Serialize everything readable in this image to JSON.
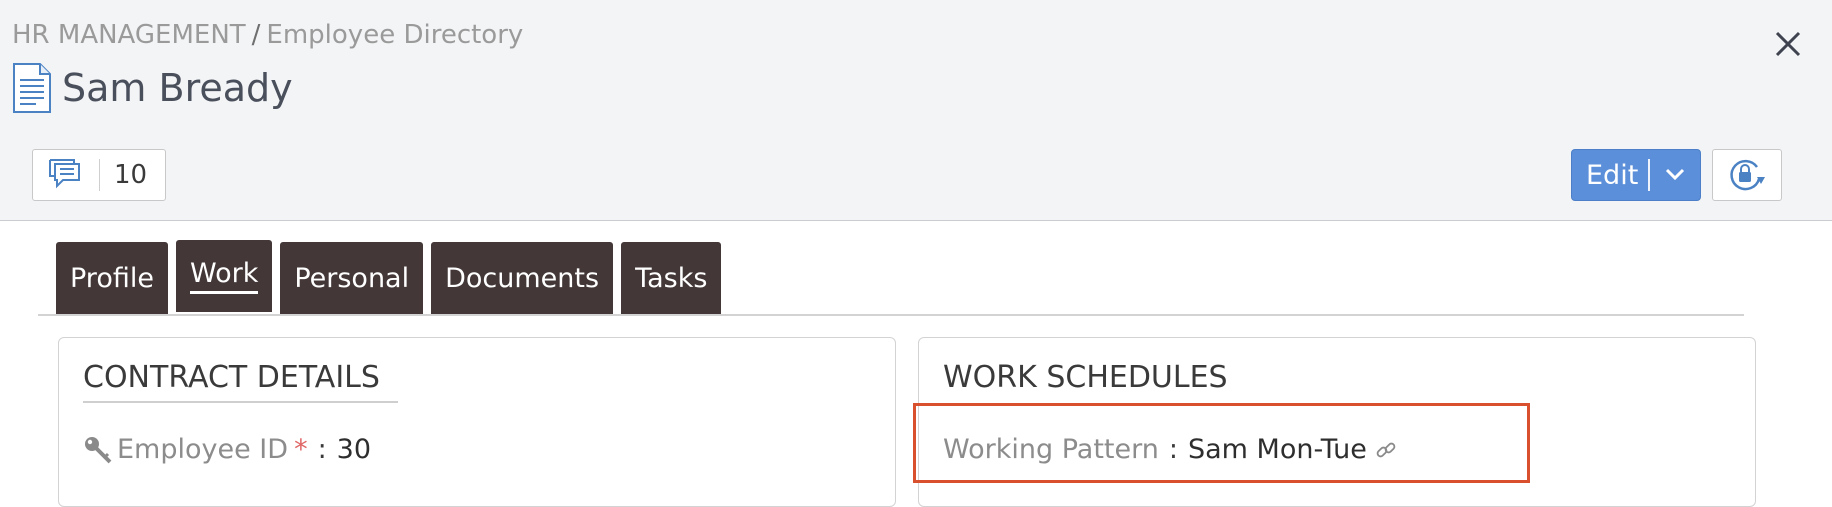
{
  "breadcrumb": {
    "section": "HR MANAGEMENT",
    "separator": "/",
    "page": "Employee Directory"
  },
  "record": {
    "title": "Sam Bready"
  },
  "header_actions": {
    "message_count": "10",
    "edit_label": "Edit"
  },
  "tabs": [
    {
      "label": "Profile",
      "active": false
    },
    {
      "label": "Work",
      "active": true
    },
    {
      "label": "Personal",
      "active": false
    },
    {
      "label": "Documents",
      "active": false
    },
    {
      "label": "Tasks",
      "active": false
    }
  ],
  "contract_details": {
    "title": "CONTRACT DETAILS",
    "employee_id_label": "Employee ID",
    "required_mark": "*",
    "colon": ":",
    "employee_id_value": "30"
  },
  "work_schedules": {
    "title": "WORK SCHEDULES",
    "working_pattern_label": "Working Pattern",
    "colon": ":",
    "working_pattern_value": "Sam Mon-Tue"
  },
  "colors": {
    "tab_bg": "#433737",
    "edit_button": "#5b8fd9",
    "highlight_border": "#d9502e",
    "header_bg": "#f3f4f6"
  },
  "icons": [
    "document-icon",
    "close-icon",
    "chat-icon",
    "chevron-down-icon",
    "lock-refresh-icon",
    "key-icon",
    "link-icon"
  ]
}
